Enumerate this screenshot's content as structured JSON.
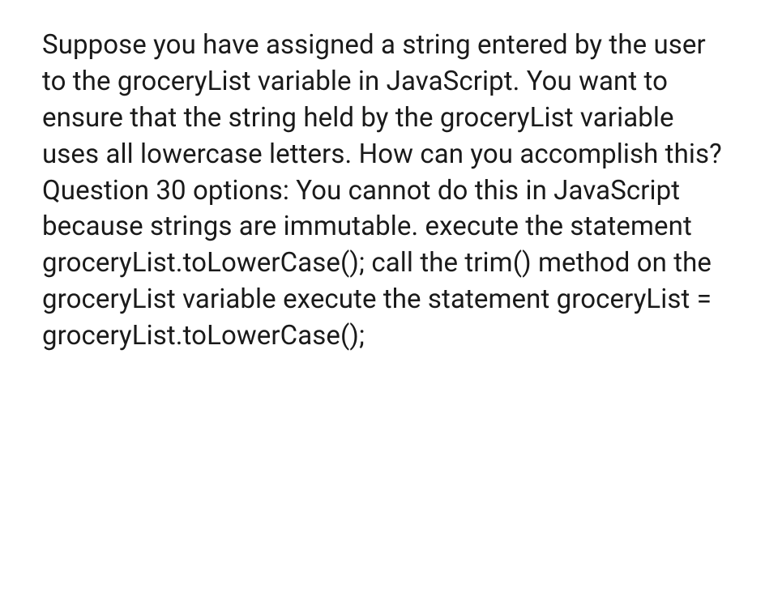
{
  "question": {
    "body": "Suppose you have assigned a string entered by the user to the groceryList variable in JavaScript. You want to ensure that the string held by the groceryList variable uses all lowercase letters. How can you accomplish this? Question 30 options: You cannot do this in JavaScript because strings are immutable. execute the statement groceryList.toLowerCase(); call the trim() method on the groceryList variable execute the statement groceryList = groceryList.toLowerCase();"
  }
}
